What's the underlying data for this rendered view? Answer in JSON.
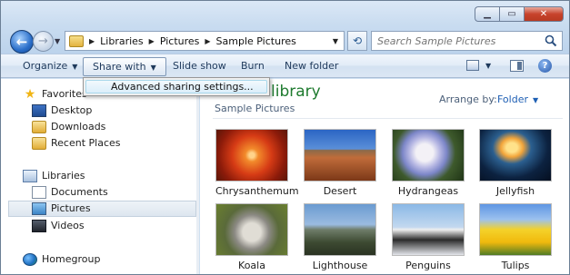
{
  "address": {
    "crumbs": [
      "Libraries",
      "Pictures",
      "Sample Pictures"
    ]
  },
  "search": {
    "placeholder": "Search Sample Pictures"
  },
  "commands": {
    "organize": "Organize",
    "share_with": "Share with",
    "slide_show": "Slide show",
    "burn": "Burn",
    "new_folder": "New folder"
  },
  "share_menu": {
    "items": [
      "Advanced sharing settings..."
    ]
  },
  "nav": {
    "favorites": "Favorites",
    "desktop": "Desktop",
    "downloads": "Downloads",
    "recent_places": "Recent Places",
    "libraries": "Libraries",
    "documents": "Documents",
    "pictures": "Pictures",
    "videos": "Videos",
    "homegroup": "Homegroup"
  },
  "content": {
    "library_title": "library",
    "subtitle": "Sample Pictures",
    "arrange_label": "Arrange by:",
    "arrange_value": "Folder",
    "thumbnails": [
      {
        "name": "Chrysanthemum"
      },
      {
        "name": "Desert"
      },
      {
        "name": "Hydrangeas"
      },
      {
        "name": "Jellyfish"
      },
      {
        "name": "Koala"
      },
      {
        "name": "Lighthouse"
      },
      {
        "name": "Penguins"
      },
      {
        "name": "Tulips"
      }
    ]
  },
  "colors": {
    "title_green": "#1e7a2e",
    "link_blue": "#1e5fb4"
  }
}
